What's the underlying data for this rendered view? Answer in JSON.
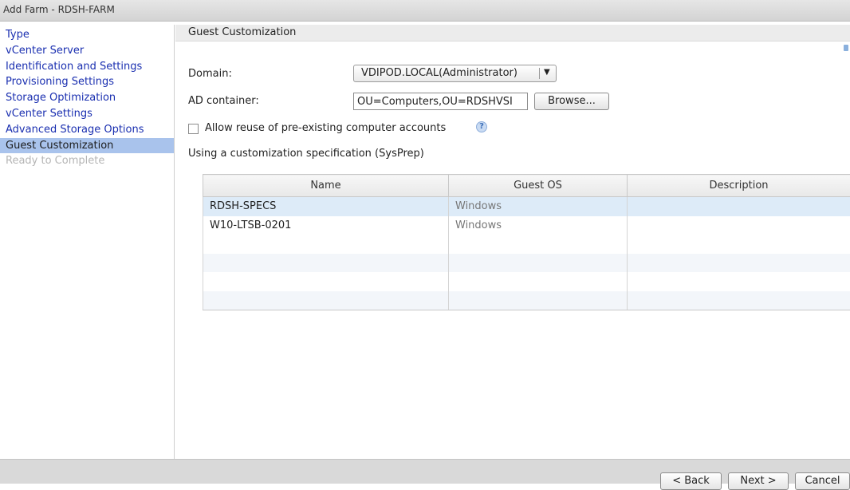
{
  "window": {
    "title": "Add Farm - RDSH-FARM"
  },
  "sidebar": {
    "items": [
      {
        "label": "Type",
        "state": "link"
      },
      {
        "label": "vCenter Server",
        "state": "link"
      },
      {
        "label": "Identification and Settings",
        "state": "link"
      },
      {
        "label": "Provisioning Settings",
        "state": "link"
      },
      {
        "label": "Storage Optimization",
        "state": "link"
      },
      {
        "label": "vCenter Settings",
        "state": "link"
      },
      {
        "label": "Advanced Storage Options",
        "state": "link"
      },
      {
        "label": "Guest Customization",
        "state": "active"
      },
      {
        "label": "Ready to Complete",
        "state": "disabled"
      }
    ]
  },
  "main": {
    "section_title": "Guest Customization",
    "domain": {
      "label": "Domain:",
      "value": "VDIPOD.LOCAL(Administrator)"
    },
    "ad_container": {
      "label": "AD container:",
      "value": "OU=Computers,OU=RDSHVSI",
      "browse_label": "Browse..."
    },
    "allow_reuse": {
      "label": "Allow reuse of pre-existing computer accounts",
      "checked": false
    },
    "spec_heading": "Using a customization specification (SysPrep)",
    "table": {
      "columns": [
        "Name",
        "Guest OS",
        "Description"
      ],
      "rows": [
        {
          "name": "RDSH-SPECS",
          "guest_os": "Windows",
          "description": "",
          "selected": true
        },
        {
          "name": "W10-LTSB-0201",
          "guest_os": "Windows",
          "description": "",
          "selected": false
        },
        {
          "name": "",
          "guest_os": "",
          "description": ""
        },
        {
          "name": "",
          "guest_os": "",
          "description": ""
        },
        {
          "name": "",
          "guest_os": "",
          "description": ""
        },
        {
          "name": "",
          "guest_os": "",
          "description": ""
        }
      ]
    }
  },
  "footer": {
    "back_label": "< Back",
    "next_label": "Next >",
    "cancel_label": "Cancel"
  },
  "colors": {
    "nav_link": "#1a2fb0",
    "nav_active_bg": "#a9c3ec",
    "selected_row": "#ddebf8"
  }
}
